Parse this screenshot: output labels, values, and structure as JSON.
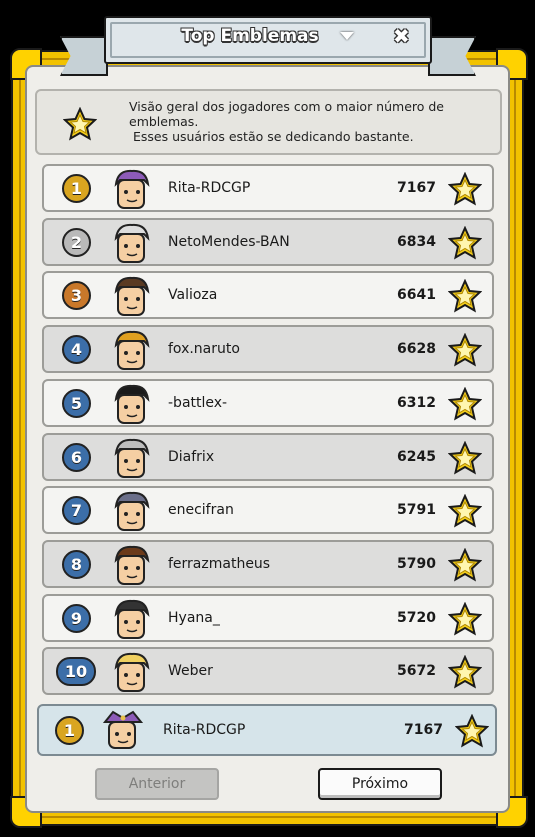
{
  "window": {
    "title": "Top Emblemas"
  },
  "info": {
    "line1": "Visão geral dos jogadores com o maior número de",
    "line2": "emblemas.",
    "line3": " Esses usuários estão se dedicando bastante."
  },
  "rows": [
    {
      "rank": "1",
      "name": "Rita-RDCGP",
      "score": "7167"
    },
    {
      "rank": "2",
      "name": "NetoMendes-BAN",
      "score": "6834"
    },
    {
      "rank": "3",
      "name": "Valioza",
      "score": "6641"
    },
    {
      "rank": "4",
      "name": "fox.naruto",
      "score": "6628"
    },
    {
      "rank": "5",
      "name": "-battlex-",
      "score": "6312"
    },
    {
      "rank": "6",
      "name": "Diafrix",
      "score": "6245"
    },
    {
      "rank": "7",
      "name": "enecifran",
      "score": "5791"
    },
    {
      "rank": "8",
      "name": "ferrazmatheus",
      "score": "5790"
    },
    {
      "rank": "9",
      "name": "Hyana_",
      "score": "5720"
    },
    {
      "rank": "10",
      "name": "Weber",
      "score": "5672"
    }
  ],
  "self": {
    "rank": "1",
    "name": "Rita-RDCGP",
    "score": "7167"
  },
  "buttons": {
    "prev": "Anterior",
    "next": "Próximo"
  },
  "colors": {
    "gold": "#d9a520",
    "silver": "#b9b9b9",
    "bronze": "#c9782a",
    "blue": "#3c6ea8",
    "frame": "#f2c200"
  }
}
